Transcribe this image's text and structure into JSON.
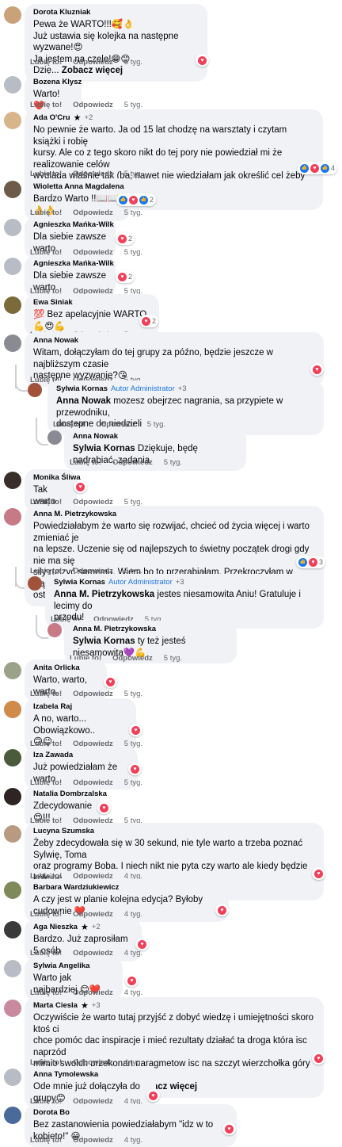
{
  "actions": {
    "like": "Lubię to!",
    "reply": "Odpowiedz",
    "see_more": "Zobacz więcej"
  },
  "comments": [
    {
      "name": "Dorota Kluzniak",
      "lines": [
        "Pewa że WARTO!!!🥰👌",
        "Już ustawia się kolejka na następne wyzwane!😍",
        "Ja jestem na czele!😁😊",
        "Dzię... "
      ],
      "see_more": true,
      "time": "5 tyg.",
      "react": "",
      "avatar": "#c9a27a"
    },
    {
      "name": "Bozena Klysz",
      "lines": [
        "Warto! ❤️"
      ],
      "time": "5 tyg.",
      "avatar": "#b8bcc4"
    },
    {
      "name": "Ada O'Cru",
      "plus": "+2",
      "lines": [
        "No pewnie że warto. Ja od 15 lat chodzę na warsztaty i czytam książki i robię",
        "kursy. Ale co z tego skoro nikt do tej pory nie powiedział mi że realizowanie celów",
        "wygląda właśnie tak (ba, nawet nie wiedziałam jak określić cel żeby mnie sam w",
        "sobie już m... "
      ],
      "see_more": true,
      "time": "5 tyg.",
      "react": "4",
      "avatar": "#d8b48a"
    },
    {
      "name": "Wioletta Anna Magdalena",
      "lines": [
        "Bardzo Warto !!📖📖👌👌"
      ],
      "time": "5 tyg.",
      "react": "2",
      "avatar": "#6e5a48"
    },
    {
      "name": "Agnieszka Mańka-Wilk",
      "lines": [
        "Dla siebie zawsze warto."
      ],
      "time": "5 tyg.",
      "react": "2",
      "avatar": "#b8bcc4"
    },
    {
      "name": "Agnieszka Mańka-Wilk",
      "lines": [
        "Dla siebie zawsze warto"
      ],
      "time": "5 tyg.",
      "react": "2",
      "avatar": "#b8bcc4"
    },
    {
      "name": "Ewa Siniak",
      "lines": [
        "💯 Bez apelacyjnie WARTO 💪😍💪"
      ],
      "time": "5 tyg.",
      "react": "2",
      "avatar": "#7b6a3a"
    },
    {
      "name": "Anna Nowak",
      "lines": [
        "Witam, dołączyłam do tej grupy za późno, będzie jeszcze w najbliższym czasie",
        "następne wyzwanie?😘"
      ],
      "time": "5 tyg.",
      "react": "",
      "avatar": "#8a8a92"
    },
    {
      "name": "Sylwia Kornas",
      "badge": "Autor   Administrator",
      "plus": "+3",
      "mention": "Anna Nowak",
      "lines": [
        " mozesz obejrzec nagrania, sa przypiete w przewodniku,",
        "dostepne do niedzieli"
      ],
      "time": "5 tyg.",
      "avatar": "#a0523a"
    },
    {
      "name": "Anna Nowak",
      "mention": "Sylwia Kornas",
      "lines": [
        " Dziękuje, będę nadrabiać. zadania"
      ],
      "time": "5 tyg.",
      "avatar": "#8a8a92"
    },
    {
      "name": "Monika Śliwa",
      "lines": [
        "Tak warto"
      ],
      "time": "5 tyg.",
      "react": "",
      "avatar": "#3a2e2a"
    },
    {
      "name": "Anna M. Pietrzykowska",
      "lines": [
        "Powiedziałabym że warto się rozwijać, chcieć od życia więcej i warto zmieniać je",
        "na lepsze. Uczenie się od najlepszych to świetny początek drogi gdy nie ma się",
        "siły ruszyć samemu. Wiem bo to przerabiałam. Przekroczyłam w ciągu kilku",
        "ostatnich lat wiele... "
      ],
      "see_more": true,
      "time": "5 tyg.",
      "react": "3",
      "avatar": "#c77a86"
    },
    {
      "name": "Sylwia Kornas",
      "badge": "Autor   Administrator",
      "plus": "+3",
      "mention": "Anna M. Pietrzykowska",
      "lines": [
        " jestes niesamowita Aniu! Gratuluje i lecimy do",
        "przodu!"
      ],
      "time": "5 tyg.",
      "avatar": "#a0523a"
    },
    {
      "name": "Anna M. Pietrzykowska",
      "mention": "Sylwia Kornas",
      "lines": [
        " ty też jesteś niesamowita💜💪"
      ],
      "time": "5 tyg.",
      "avatar": "#c77a86"
    },
    {
      "name": "Anita Orlicka",
      "lines": [
        "Warto, warto, warto."
      ],
      "time": "5 tyg.",
      "avatar": "#9aa38a"
    },
    {
      "name": "Izabela Raj",
      "lines": [
        "A no, warto... Obowiązkowo..",
        "🙃😉"
      ],
      "time": "5 tyg.",
      "avatar": "#d08a4a"
    },
    {
      "name": "Iza Zawada",
      "lines": [
        "Już powiedziałam że warto"
      ],
      "time": "5 tyg.",
      "avatar": "#4a5a3a"
    },
    {
      "name": "Natalia Dombrzalska",
      "lines": [
        "Zdecydowanie😍!!!"
      ],
      "time": "5 tyg.",
      "avatar": "#2e2424"
    },
    {
      "name": "Lucyna Szumska",
      "lines": [
        "Żeby zdecydowała się w 30 sekund, nie tyle warto a trzeba poznać Sylwię, Toma",
        "oraz programy Boba. I niech nikt nie pyta czy warto ale kiedy będzie kolejne",
        "spotkanie😁"
      ],
      "time": "4 tyg.",
      "avatar": "#b89a80"
    },
    {
      "name": "Barbara Wardziukiewicz",
      "lines": [
        "A czy jest w planie kolejna edycja? Byłoby cudownie ❤️"
      ],
      "time": "4 tyg.",
      "avatar": "#7f8a5a"
    },
    {
      "name": "Aga Nieszka",
      "plus": "+2",
      "lines": [
        "Bardzo. Już zaprosiłam 5 osób"
      ],
      "time": "4 tyg.",
      "avatar": "#3a3a3a"
    },
    {
      "name": "Sylwia Angelika",
      "lines": [
        "Warto jak najbardziej 😊❤️"
      ],
      "time": "4 tyg.",
      "avatar": "#b8bcc4"
    },
    {
      "name": "Marta Ciesla",
      "plus": "+3",
      "lines": [
        "Oczywiście że warto tutaj przyjść z dobyć wiedzę i umiejętności skoro ktoś ci",
        "chce pomóc dac inspiracje i mieć rezultaty działać ta droga która isc naprzód",
        "mimio swoich przekonan paragmetow isc na szczyt wierzchołka góry 😊dziękuję",
        "za przekazane wiedzę ... "
      ],
      "see_more": true,
      "time": "4 tyg.",
      "avatar": "#c98aa0"
    },
    {
      "name": "Anna Tymolewska",
      "lines": [
        "Ode mnie już dołączyła do grupy😊"
      ],
      "time": "4 tyg.",
      "avatar": "#b8bcc4"
    },
    {
      "name": "Dorota Bo",
      "lines": [
        "Bez zastanowienia powiedziałabym \"idz w to kobieto!\" 😀"
      ],
      "time": "4 tyg.",
      "avatar": "#4a6a9a"
    }
  ]
}
